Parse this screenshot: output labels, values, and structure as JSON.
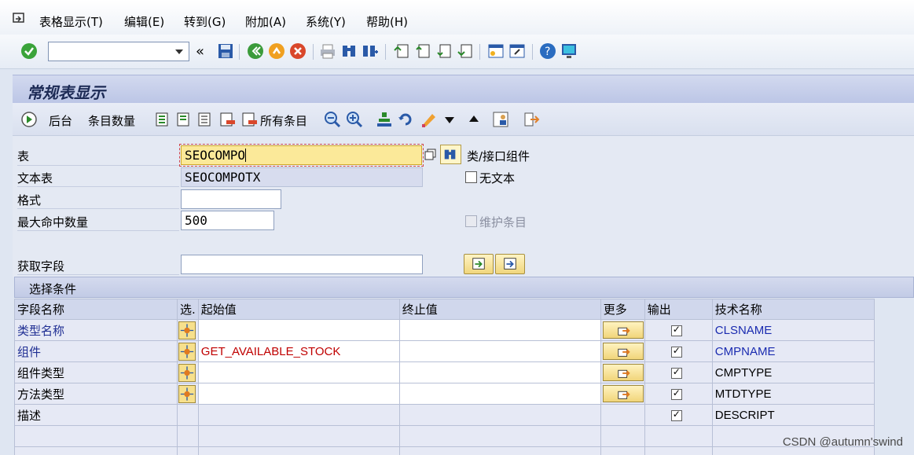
{
  "menu": [
    "表格显示(T)",
    "编辑(E)",
    "转到(G)",
    "附加(A)",
    "系统(Y)",
    "帮助(H)"
  ],
  "toolbar": {
    "command_field_value": ""
  },
  "title": "常规表显示",
  "app_toolbar": {
    "background_label": "后台",
    "count_label": "条目数量",
    "all_entries_label": "所有条目"
  },
  "form": {
    "table_label": "表",
    "table_value": "SEOCOMPO",
    "text_table_label": "文本表",
    "text_table_value": "SEOCOMPOTX",
    "format_label": "格式",
    "format_value": "",
    "max_hits_label": "最大命中数量",
    "max_hits_value": "500",
    "class_component_label": "类/接口组件",
    "no_text_label": "无文本",
    "maintain_entries_label": "维护条目",
    "get_fields_label": "获取字段",
    "get_fields_value": ""
  },
  "selection": {
    "header": "选择条件",
    "columns": [
      "字段名称",
      "选.",
      "起始值",
      "终止值",
      "更多",
      "输出",
      "技术名称"
    ],
    "rows": [
      {
        "field": "类型名称",
        "from": "",
        "to": "",
        "tech": "CLSNAME"
      },
      {
        "field": "组件",
        "from": "GET_AVAILABLE_STOCK",
        "to": "",
        "tech": "CMPNAME"
      },
      {
        "field": "组件类型",
        "from": "",
        "to": "",
        "tech": "CMPTYPE"
      },
      {
        "field": "方法类型",
        "from": "",
        "to": "",
        "tech": "MTDTYPE"
      },
      {
        "field": "描述",
        "from": "",
        "to": "",
        "tech": "DESCRIPT"
      }
    ]
  },
  "watermark": "CSDN @autumn'swind"
}
